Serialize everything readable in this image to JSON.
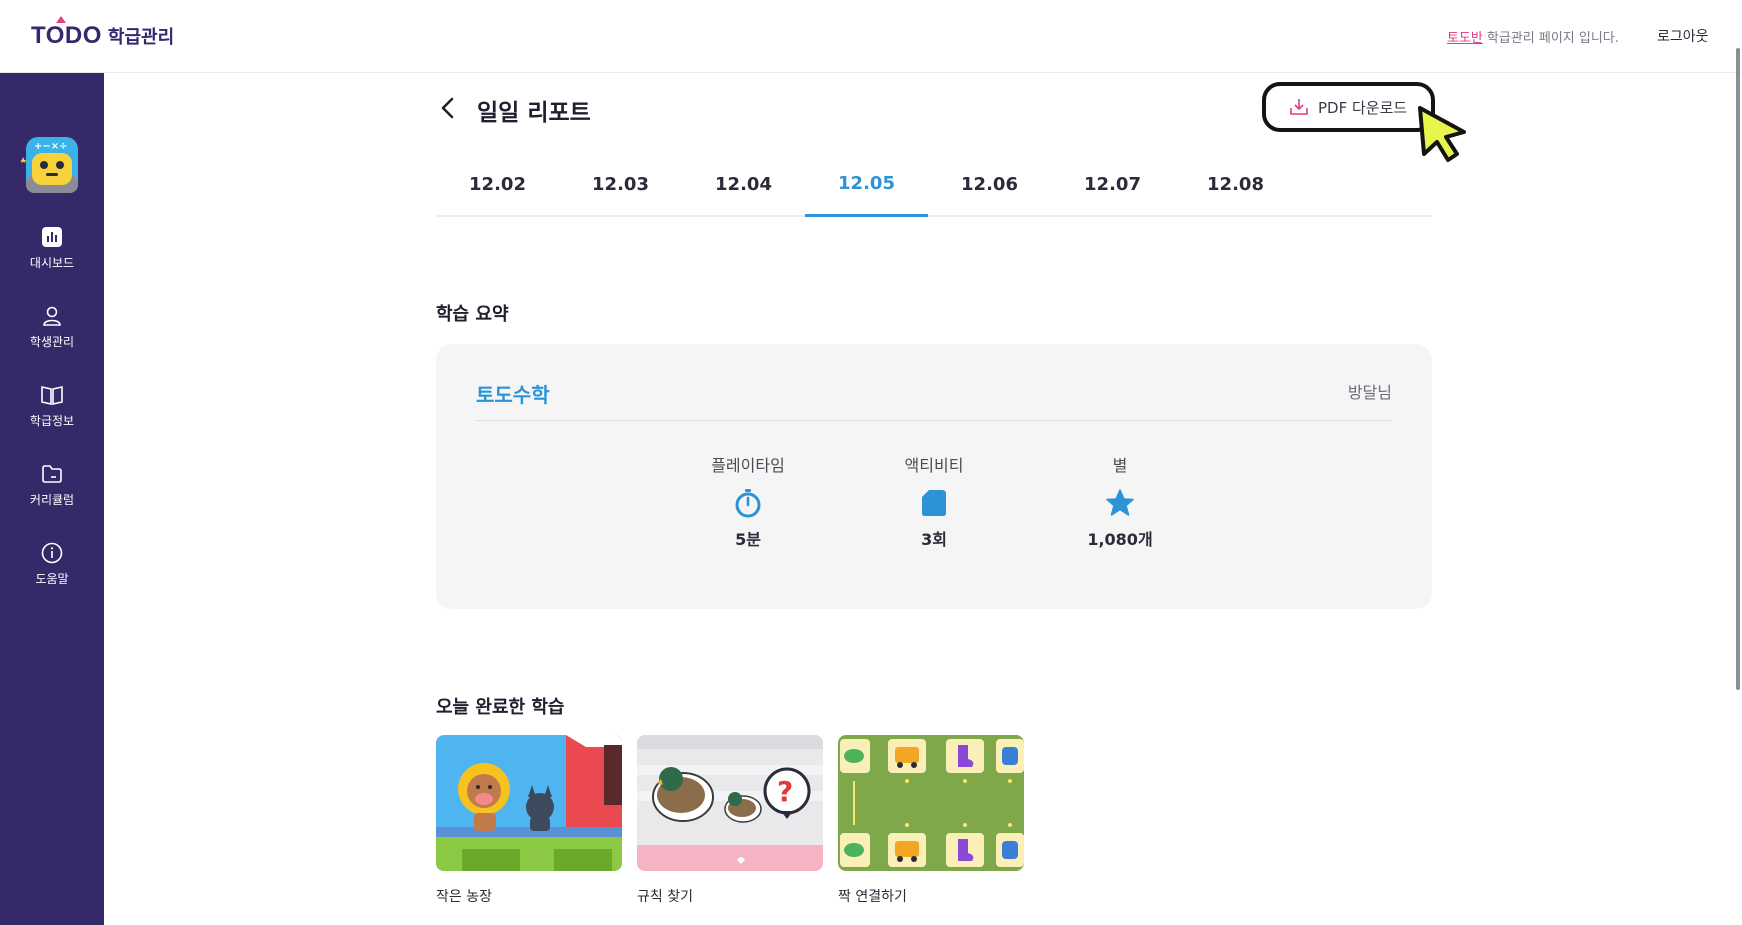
{
  "header": {
    "logo_text": "TODO",
    "logo_sub": "학급관리",
    "notice_class": "토도반",
    "notice_text": "학급관리 페이지 입니다.",
    "logout": "로그아웃"
  },
  "sidebar": {
    "items": [
      {
        "label": "대시보드",
        "icon": "bar-chart-icon"
      },
      {
        "label": "학생관리",
        "icon": "person-icon"
      },
      {
        "label": "학급정보",
        "icon": "book-icon"
      },
      {
        "label": "커리큘럼",
        "icon": "folder-icon"
      },
      {
        "label": "도움말",
        "icon": "info-icon"
      }
    ]
  },
  "page": {
    "title": "일일 리포트",
    "pdf_button": "PDF 다운로드"
  },
  "tabs": [
    "12.02",
    "12.03",
    "12.04",
    "12.05",
    "12.06",
    "12.07",
    "12.08"
  ],
  "active_tab": "12.05",
  "summary": {
    "section_title": "학습 요약",
    "subject": "토도수학",
    "teacher": "방달님",
    "stats": [
      {
        "label": "플레이타임",
        "value": "5분",
        "icon": "timer-icon"
      },
      {
        "label": "액티비티",
        "value": "3회",
        "icon": "document-icon"
      },
      {
        "label": "별",
        "value": "1,080개",
        "icon": "star-icon"
      }
    ]
  },
  "completed": {
    "section_title": "오늘 완료한 학습",
    "items": [
      {
        "caption": "작은 농장",
        "icon": "farm-animals-thumbnail"
      },
      {
        "caption": "규칙 찾기",
        "icon": "duck-pattern-thumbnail"
      },
      {
        "caption": "짝 연결하기",
        "icon": "matching-cards-thumbnail"
      }
    ]
  },
  "colors": {
    "sidebar_bg": "#352969",
    "accent_blue": "#2b93d6",
    "accent_pink": "#e03b85",
    "card_bg": "#f5f5f6"
  }
}
